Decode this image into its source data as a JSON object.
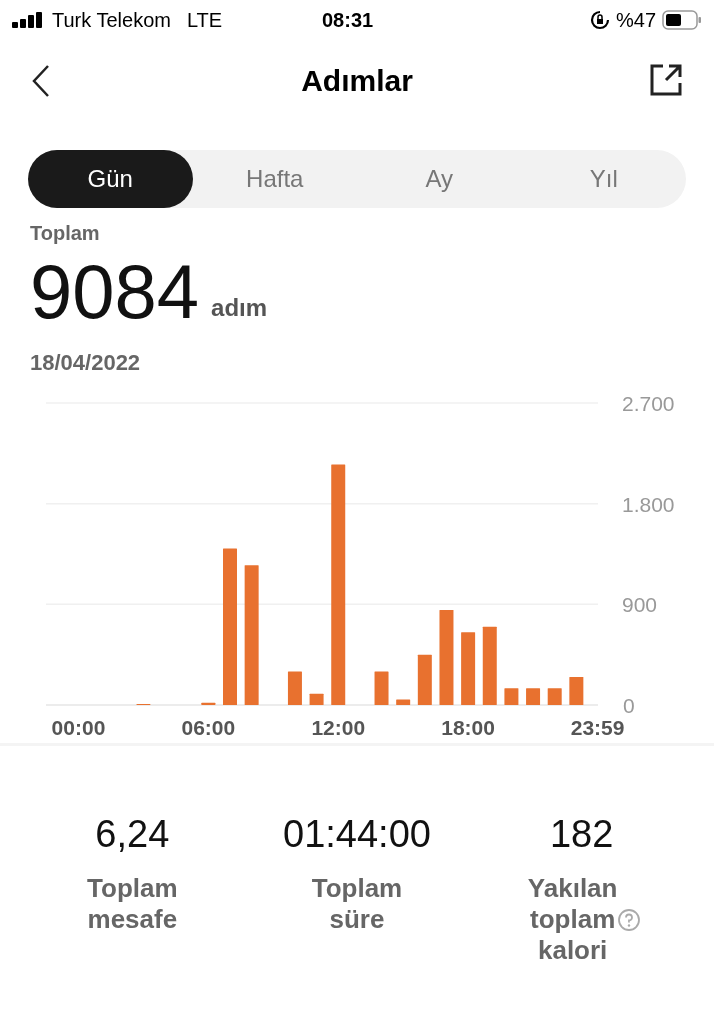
{
  "status_bar": {
    "carrier": "Turk Telekom",
    "network": "LTE",
    "time": "08:31",
    "battery": "%47"
  },
  "header": {
    "title": "Adımlar"
  },
  "tabs": [
    {
      "label": "Gün",
      "selected": true
    },
    {
      "label": "Hafta",
      "selected": false
    },
    {
      "label": "Ay",
      "selected": false
    },
    {
      "label": "Yıl",
      "selected": false
    }
  ],
  "total": {
    "label": "Toplam",
    "value": "9084",
    "unit": "adım",
    "date": "18/04/2022"
  },
  "chart_data": {
    "type": "bar",
    "x": [
      0,
      1,
      2,
      3,
      4,
      5,
      6,
      7,
      8,
      9,
      10,
      11,
      12,
      13,
      14,
      15,
      16,
      17,
      18,
      19,
      20,
      21,
      22,
      23
    ],
    "xlim": [
      -1.5,
      24
    ],
    "series": [
      {
        "color": "#e8712f",
        "values": [
          0,
          0,
          0,
          10,
          0,
          0,
          20,
          1400,
          1250,
          0,
          300,
          100,
          2150,
          0,
          300,
          50,
          450,
          850,
          650,
          700,
          150,
          150,
          150,
          250
        ]
      }
    ],
    "xticks": [
      {
        "value": 0,
        "label": "00:00"
      },
      {
        "value": 6,
        "label": "06:00"
      },
      {
        "value": 12,
        "label": "12:00"
      },
      {
        "value": 18,
        "label": "18:00"
      },
      {
        "value": 23.98,
        "label": "23:59"
      }
    ],
    "ylim": [
      0,
      2700
    ],
    "yticks": [
      {
        "value": 0,
        "label": "0"
      },
      {
        "value": 900,
        "label": "900"
      },
      {
        "value": 1800,
        "label": "1.800"
      },
      {
        "value": 2700,
        "label": "2.700"
      }
    ]
  },
  "stats": [
    {
      "value": "6,24",
      "label": "Toplam mesafe",
      "info": false
    },
    {
      "value": "01:44:00",
      "label": "Toplam süre",
      "info": false
    },
    {
      "value": "182",
      "label": "Yakılan toplam kalori",
      "info": true
    }
  ]
}
